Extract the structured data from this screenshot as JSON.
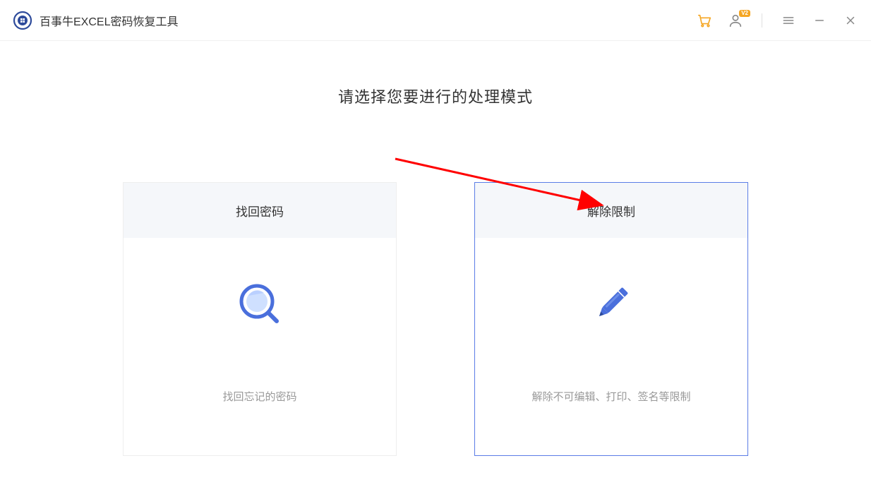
{
  "app": {
    "title": "百事牛EXCEL密码恢复工具",
    "user_badge": "V2"
  },
  "main": {
    "heading": "请选择您要进行的处理模式"
  },
  "cards": {
    "recover": {
      "title": "找回密码",
      "description": "找回忘记的密码"
    },
    "unlock": {
      "title": "解除限制",
      "description": "解除不可编辑、打印、签名等限制"
    }
  }
}
